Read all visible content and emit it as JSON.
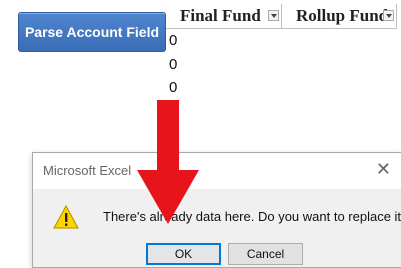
{
  "sheet": {
    "parse_button_label": "Parse Account Field",
    "columns": [
      "Final Fund",
      "Rollup Fund"
    ],
    "cells": [
      "0",
      "0",
      "0"
    ]
  },
  "dialog": {
    "title": "Microsoft Excel",
    "close_glyph": "✕",
    "message": "There's already data here. Do you want to replace it?",
    "ok_label": "OK",
    "cancel_label": "Cancel",
    "icon": "warning-icon"
  },
  "annotation": {
    "arrow_icon": "red-down-arrow-icon",
    "arrow_color": "#e8141b"
  },
  "colors": {
    "button_blue": "#3a6db5",
    "ok_border": "#0078d7",
    "warning_yellow": "#ffd500"
  }
}
